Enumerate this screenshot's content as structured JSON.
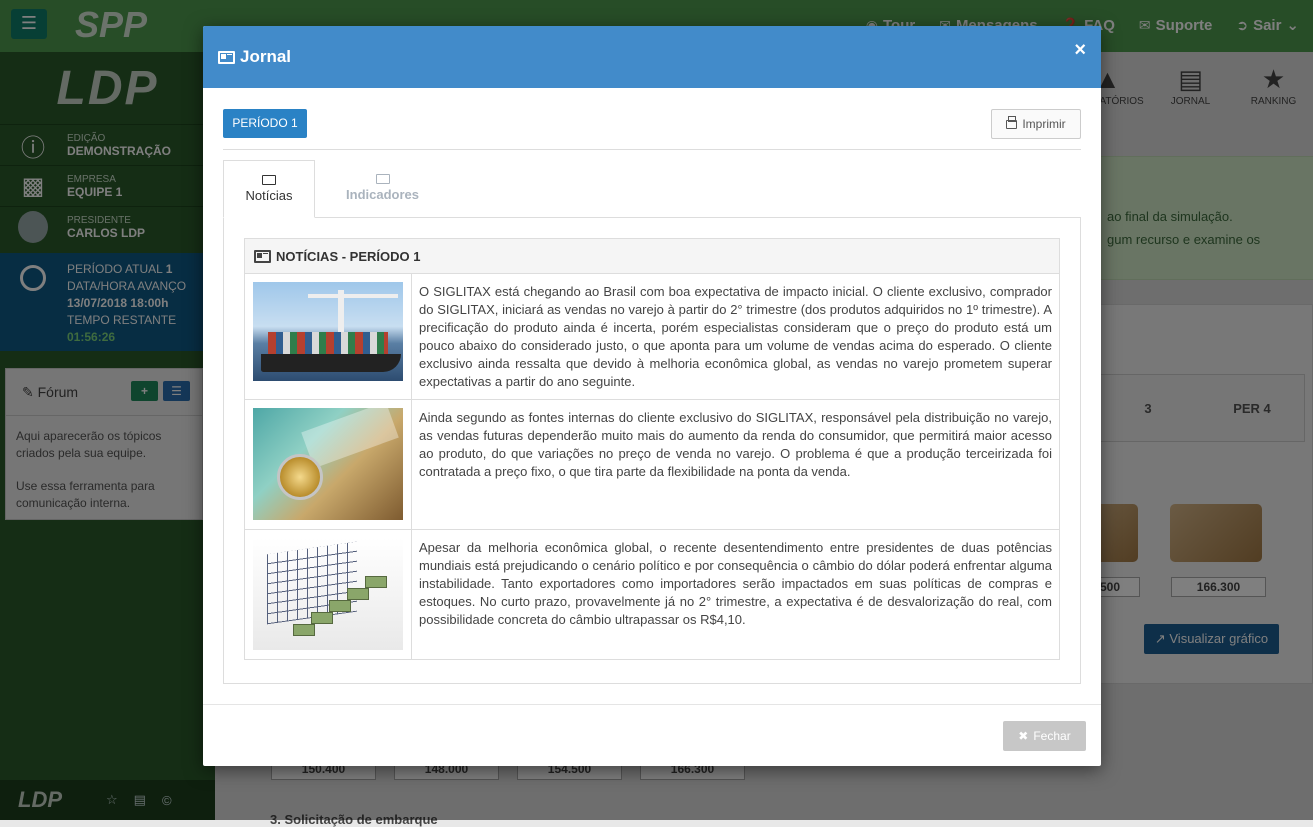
{
  "app": {
    "title": "SPP",
    "topnav": [
      {
        "icon": "tour-icon",
        "label": "Tour"
      },
      {
        "icon": "envelope-icon",
        "label": "Mensagens"
      },
      {
        "icon": "question-icon",
        "label": "FAQ"
      },
      {
        "icon": "envelope-icon",
        "label": "Suporte"
      },
      {
        "icon": "sign-out-icon",
        "label": "Sair"
      }
    ]
  },
  "sidebar": {
    "logo": "LDP",
    "edition_label": "EDIÇÃO",
    "edition_value": "DEMONSTRAÇÃO",
    "company_label": "EMPRESA",
    "company_value": "EQUIPE 1",
    "president_label": "PRESIDENTE",
    "president_value": "CARLOS LDP",
    "period_label": "PERÍODO ATUAL",
    "period_value": "1",
    "advance_label": "DATA/HORA AVANÇO",
    "advance_value": "13/07/2018 18:00h",
    "remaining_label": "TEMPO RESTANTE",
    "remaining_value": "01:56:26",
    "forum_title": "Fórum",
    "forum_text1": "Aqui aparecerão os tópicos criados pela sua equipe.",
    "forum_text2": "Use essa ferramenta para comunicação interna.",
    "footer_logo": "LDP"
  },
  "content": {
    "nav": [
      {
        "icon": "chart-icon",
        "label": "RELATÓRIOS"
      },
      {
        "icon": "newspaper-icon",
        "label": "JORNAL"
      },
      {
        "icon": "trophy-icon",
        "label": "RANKING"
      }
    ],
    "alert_line1": "ao final da simulação.",
    "alert_line2": "gum recurso e examine os",
    "per_headers": [
      "3",
      "PER 4"
    ],
    "right_values": [
      "500",
      "166.300"
    ],
    "viz_button": "Visualizar gráfico",
    "bottom_values": [
      "150.400",
      "148.000",
      "154.500",
      "166.300"
    ],
    "bottom_title": "3. Solicitação de embarque"
  },
  "modal": {
    "title": "Jornal",
    "period_button": "PERÍODO 1",
    "print_button": "Imprimir",
    "tabs": [
      {
        "label": "Notícias",
        "active": true
      },
      {
        "label": "Indicadores",
        "active": false
      }
    ],
    "news_header": "NOTÍCIAS - PERÍODO 1",
    "news": [
      {
        "image": "cargo-ship-image",
        "text": "O SIGLITAX está chegando ao Brasil com boa expectativa de impacto inicial. O cliente exclusivo, comprador do SIGLITAX, iniciará as vendas no varejo à partir do 2° trimestre (dos produtos adquiridos no 1º trimestre). A precificação do produto ainda é incerta, porém especialistas consideram que o preço do produto está um pouco abaixo do considerado justo, o que aponta para um volume de vendas acima do esperado. O cliente exclusivo ainda ressalta que devido à melhoria econômica global, as vendas no varejo prometem superar expectativas a partir do ano seguinte."
      },
      {
        "image": "money-coins-image",
        "text": "Ainda segundo as fontes internas do cliente exclusivo do SIGLITAX, responsável pela distribuição no varejo, as vendas futuras dependerão muito mais do aumento da renda do consumidor, que permitirá maior acesso ao produto, do que variações no preço de venda no varejo. O problema é que a produção terceirizada foi contratada a preço fixo, o que tira parte da flexibilidade na ponta da venda."
      },
      {
        "image": "money-stairs-chart-image",
        "text": "Apesar da melhoria econômica global, o recente desentendimento entre presidentes de duas potências mundiais está prejudicando o cenário político e por consequência o câmbio do dólar poderá enfrentar alguma instabilidade. Tanto exportadores como importadores serão impactados em suas políticas de compras e estoques. No curto prazo, provavelmente já no 2° trimestre, a expectativa é de desvalorização do real, com possibilidade concreta do câmbio ultrapassar os R$4,10."
      }
    ],
    "close_button": "Fechar"
  },
  "colors": {
    "modal_header": "#428bca",
    "primary_button": "#2a82c5",
    "sidebar": "#2b5b2b",
    "topbar": "#4f9a4f"
  }
}
